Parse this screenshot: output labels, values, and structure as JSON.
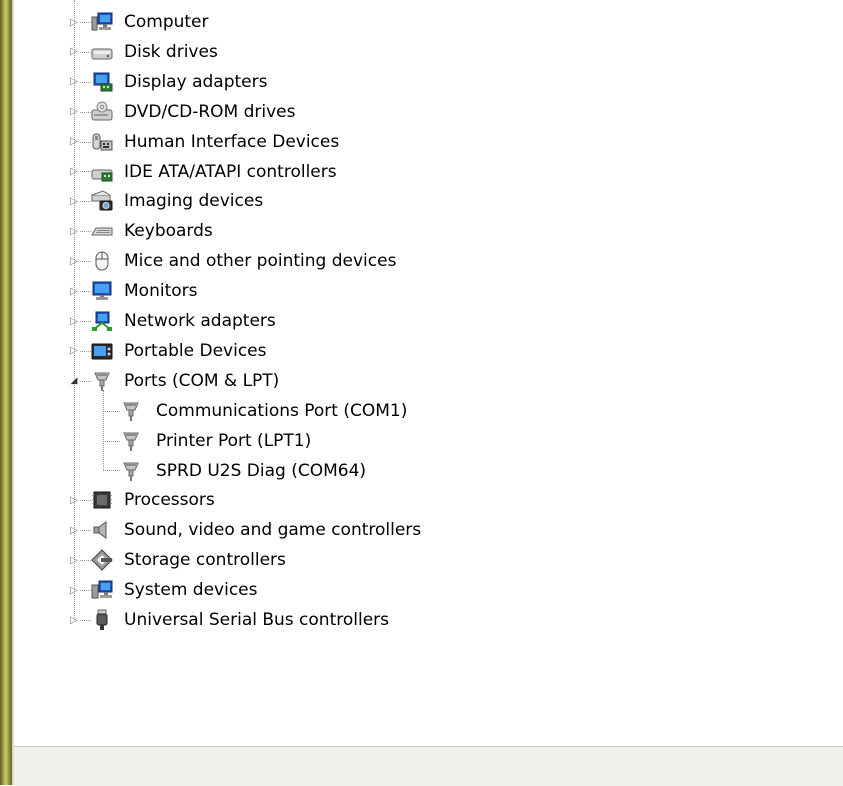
{
  "tree": {
    "categories": [
      {
        "label": "Computer",
        "icon": "computer-icon"
      },
      {
        "label": "Disk drives",
        "icon": "disk-drive-icon"
      },
      {
        "label": "Display adapters",
        "icon": "display-adapter-icon"
      },
      {
        "label": "DVD/CD-ROM drives",
        "icon": "dvd-drive-icon"
      },
      {
        "label": "Human Interface Devices",
        "icon": "hid-icon"
      },
      {
        "label": "IDE ATA/ATAPI controllers",
        "icon": "ide-controller-icon"
      },
      {
        "label": "Imaging devices",
        "icon": "imaging-device-icon"
      },
      {
        "label": "Keyboards",
        "icon": "keyboard-icon"
      },
      {
        "label": "Mice and other pointing devices",
        "icon": "mouse-icon"
      },
      {
        "label": "Monitors",
        "icon": "monitor-icon"
      },
      {
        "label": "Network adapters",
        "icon": "network-adapter-icon"
      },
      {
        "label": "Portable Devices",
        "icon": "portable-device-icon"
      },
      {
        "label": "Ports (COM & LPT)",
        "icon": "port-icon",
        "expanded": true,
        "children": [
          {
            "label": "Communications Port (COM1)",
            "icon": "port-icon"
          },
          {
            "label": "Printer Port (LPT1)",
            "icon": "port-icon"
          },
          {
            "label": "SPRD U2S Diag (COM64)",
            "icon": "port-icon"
          }
        ]
      },
      {
        "label": "Processors",
        "icon": "processor-icon"
      },
      {
        "label": "Sound, video and game controllers",
        "icon": "sound-icon"
      },
      {
        "label": "Storage controllers",
        "icon": "storage-controller-icon"
      },
      {
        "label": "System devices",
        "icon": "system-device-icon"
      },
      {
        "label": "Universal Serial Bus controllers",
        "icon": "usb-icon"
      }
    ]
  },
  "status_bar": {
    "text": ""
  }
}
